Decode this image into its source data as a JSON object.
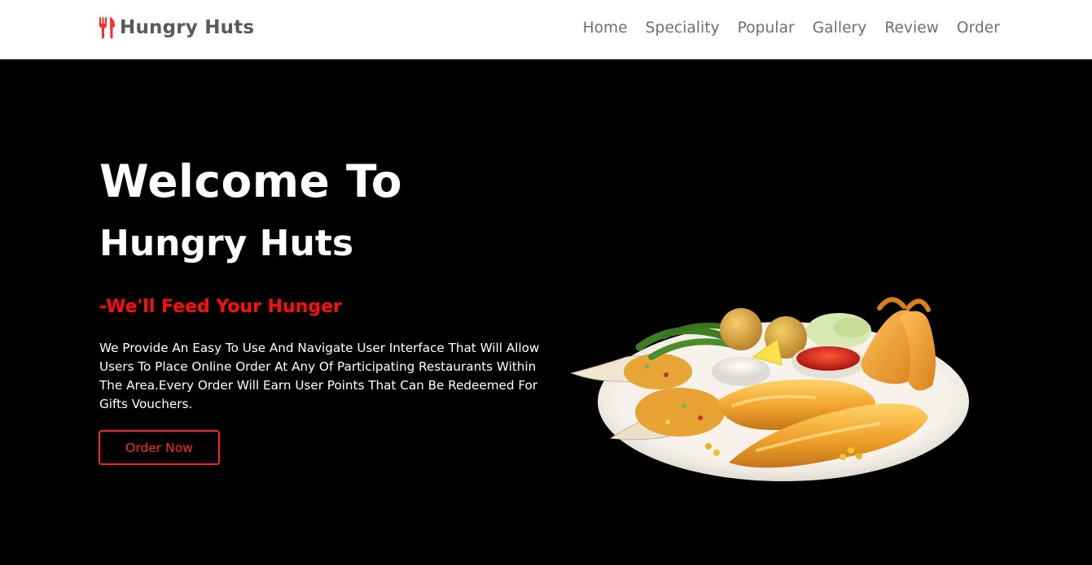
{
  "brand": {
    "name": "Hungry Huts",
    "icon": "utensils-icon",
    "icon_color": "#ff2b2b"
  },
  "nav": {
    "items": [
      {
        "label": "Home"
      },
      {
        "label": "Speciality"
      },
      {
        "label": "Popular"
      },
      {
        "label": "Gallery"
      },
      {
        "label": "Review"
      },
      {
        "label": "Order"
      }
    ]
  },
  "hero": {
    "title_line_1": "Welcome To",
    "title_line_2": "Hungry Huts",
    "tagline": "-We'll Feed Your Hunger",
    "description": "We Provide An Easy To Use And Navigate User Interface That Will Allow Users To Place Online Order At Any Of Participating Restaurants Within The Area.Every Order Will Earn User Points That Can Be Redeemed For Gifts Vouchers.",
    "button_label": "Order Now",
    "image": "fried-seafood-platter-image"
  },
  "colors": {
    "accent": "#ff0d0d",
    "background": "#000000",
    "navbar": "#ffffff",
    "nav_text": "#6e6e6e"
  }
}
